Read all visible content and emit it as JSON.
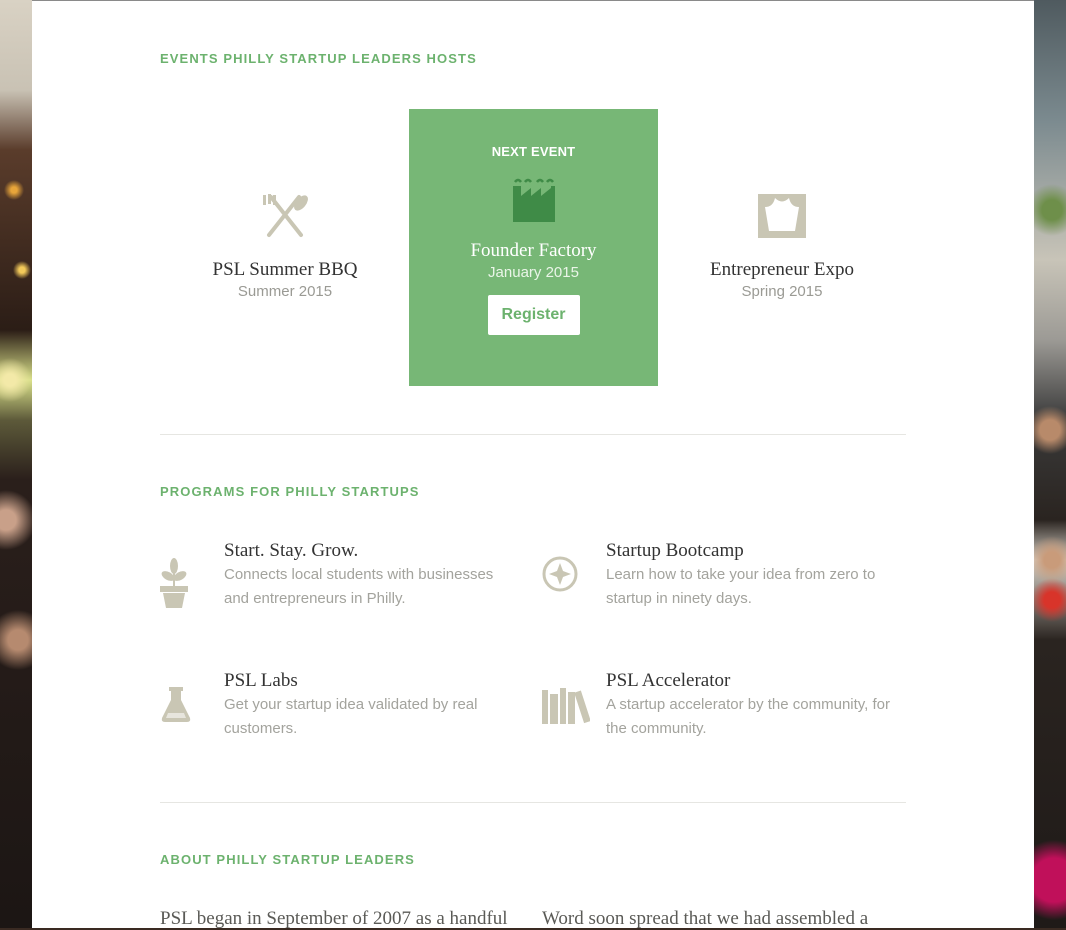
{
  "events_section": {
    "title": "EVENTS PHILLY STARTUP LEADERS HOSTS",
    "events": [
      {
        "name": "PSL Summer BBQ",
        "date": "Summer 2015",
        "icon": "fork-knife-icon"
      },
      {
        "name": "Founder Factory",
        "date": "January 2015",
        "icon": "factory-icon",
        "label": "NEXT EVENT",
        "button": "Register"
      },
      {
        "name": "Entrepreneur Expo",
        "date": "Spring 2015",
        "icon": "stage-icon"
      }
    ]
  },
  "programs_section": {
    "title": "PROGRAMS FOR PHILLY STARTUPS",
    "programs": [
      {
        "name": "Start. Stay. Grow.",
        "desc_1": "Connects local students with businesses",
        "desc_2": "and entrepreneurs in Philly.",
        "icon": "potted-plant-icon"
      },
      {
        "name": "Startup Bootcamp",
        "desc_1": "Learn how to take your idea from zero to",
        "desc_2": "startup in ninety days.",
        "icon": "compass-icon"
      },
      {
        "name": "PSL Labs",
        "desc_1": "Get your startup idea validated by real",
        "desc_2": "customers.",
        "icon": "flask-icon"
      },
      {
        "name": "PSL Accelerator",
        "desc_1": "A startup accelerator by the community, for",
        "desc_2": "the community.",
        "icon": "books-icon"
      }
    ]
  },
  "about_section": {
    "title": "ABOUT PHILLY STARTUP LEADERS",
    "col1": "PSL began in September of 2007 as a handful",
    "col2": "Word soon spread that we had assembled a"
  },
  "colors": {
    "accent": "#6cb26e",
    "card": "#77b776",
    "icon": "#c9c6b4"
  }
}
